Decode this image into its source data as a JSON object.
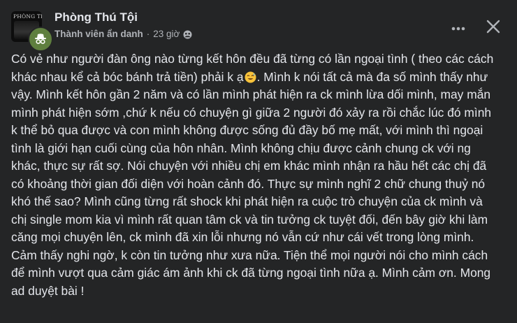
{
  "post": {
    "group_name": "Phòng Thú Tội",
    "group_avatar_text": "PHÒNG THÚ T",
    "author": "Thành viên ẩn danh",
    "separator": "·",
    "time": "23 giờ",
    "privacy_icon": "group-audience-icon",
    "body_part1": "Có vẻ như người đàn ông nào từng kết hôn đều đã từng có lần ngoại tình ( theo các cách khác nhau kể cả bóc bánh trả tiền) phải k ạ",
    "emoji_icon": "sweat-smile-emoji-icon",
    "body_part2": ". Mình k nói tất cả mà đa số mình thấy như vậy. Mình kết hôn gần 2 năm và có lần mình phát hiện ra ck mình lừa dối mình, may mắn mình phát hiện sớm ,chứ k nếu có chuyện gì giữa 2 người đó xảy ra rồi chắc lúc đó mình k thể bỏ qua được và con mình không được sống đủ đầy bố mẹ mất, với mình thì ngoại tình là giới hạn cuối cùng của hôn nhân. Mình không chịu được cảnh chung ck với ng khác, thực sự rất sợ. Nói chuyện với nhiều chị em khác mình nhận ra hầu hết các chị đã có khoảng thời gian đối diện với hoàn cảnh đó. Thực sự mình nghĩ 2 chữ chung thuỷ nó khó thế sao? Mình cũng từng rất shock khi phát hiện ra cuộc trò chuyện của ck mình và chị single mom kia vì mình rất quan tâm ck và tin tưởng ck tuyệt đối, đến bây giờ khi làm căng mọi chuyện lên, ck mình đã xin lỗi nhưng nó vẫn cứ như cái vết trong lòng mình. Cảm thấy nghi ngờ, k còn tin tưởng như xưa nữa. Tiện thể mọi người nói cho mình cách để mình vượt qua cảm giác ám ảnh khi ck đã từng ngoại tình nữa ạ. Mình cảm ơn. Mong ad duyệt bài !"
  },
  "actions": {
    "more_icon": "more-horizontal-icon",
    "close_icon": "close-icon"
  },
  "colors": {
    "background": "#242526",
    "primary_text": "#e4e6eb",
    "secondary_text": "#b0b3b8",
    "anon_avatar": "#5f7f3f"
  }
}
